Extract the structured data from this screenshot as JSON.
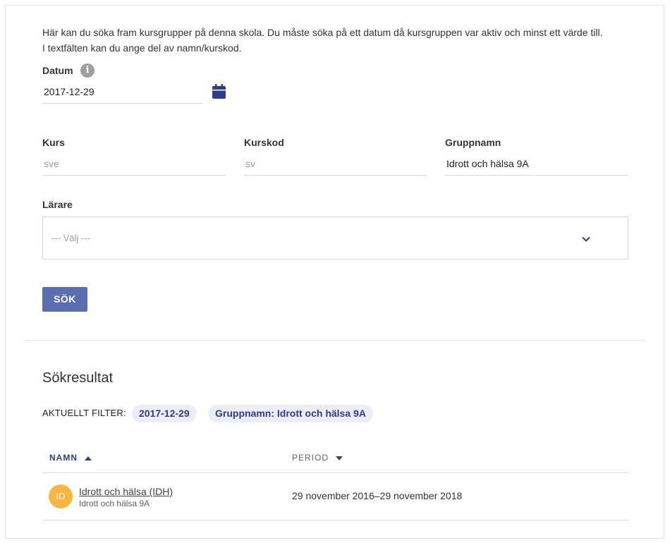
{
  "intro": "Här kan du söka fram kursgrupper på denna skola. Du måste söka på ett datum då kursgruppen var aktiv och minst ett värde till. I textfälten kan du ange del av namn/kurskod.",
  "date": {
    "label": "Datum",
    "value": "2017-12-29",
    "info_icon": "info-icon",
    "calendar_icon": "calendar-icon"
  },
  "kurs": {
    "label": "Kurs",
    "placeholder": "sve",
    "value": ""
  },
  "kurskod": {
    "label": "Kurskod",
    "placeholder": "sv",
    "value": ""
  },
  "gruppnamn": {
    "label": "Gruppnamn",
    "value": "Idrott och hälsa 9A"
  },
  "larare": {
    "label": "Lärare",
    "placeholder": "--- Välj ---"
  },
  "search_button": "SÖK",
  "results": {
    "title": "Sökresultat",
    "filter_label": "AKTUELLT FILTER:",
    "chips": [
      "2017-12-29",
      "Gruppnamn: Idrott och hälsa 9A"
    ],
    "columns": {
      "name": "NAMN",
      "period": "PERIOD"
    },
    "rows": [
      {
        "initials": "ID",
        "title": "Idrott och hälsa (IDH)",
        "subtitle": "Idrott och hälsa 9A",
        "period": "29 november 2016–29 november 2018"
      }
    ]
  },
  "colors": {
    "accent": "#2f3c86",
    "button": "#5b6eb1",
    "avatar": "#f9b540"
  }
}
